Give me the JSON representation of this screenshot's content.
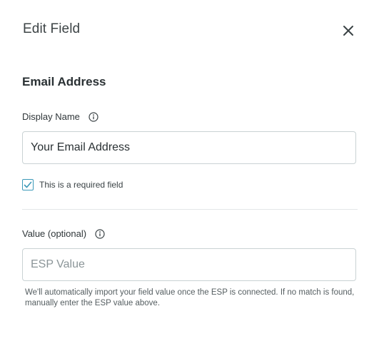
{
  "dialog": {
    "title": "Edit Field",
    "close_icon": "close-icon"
  },
  "field": {
    "name": "Email Address"
  },
  "display_name": {
    "label": "Display Name",
    "info_icon": "info-icon",
    "value": "Your Email Address"
  },
  "required": {
    "label": "This is a required field",
    "checked": true,
    "accent_color": "#3c99b8"
  },
  "value_field": {
    "label": "Value (optional)",
    "info_icon": "info-icon",
    "value": "",
    "placeholder": "ESP Value",
    "help": "We'll automatically import your field value once the ESP is connected. If no match is found, manually enter the ESP value above."
  }
}
